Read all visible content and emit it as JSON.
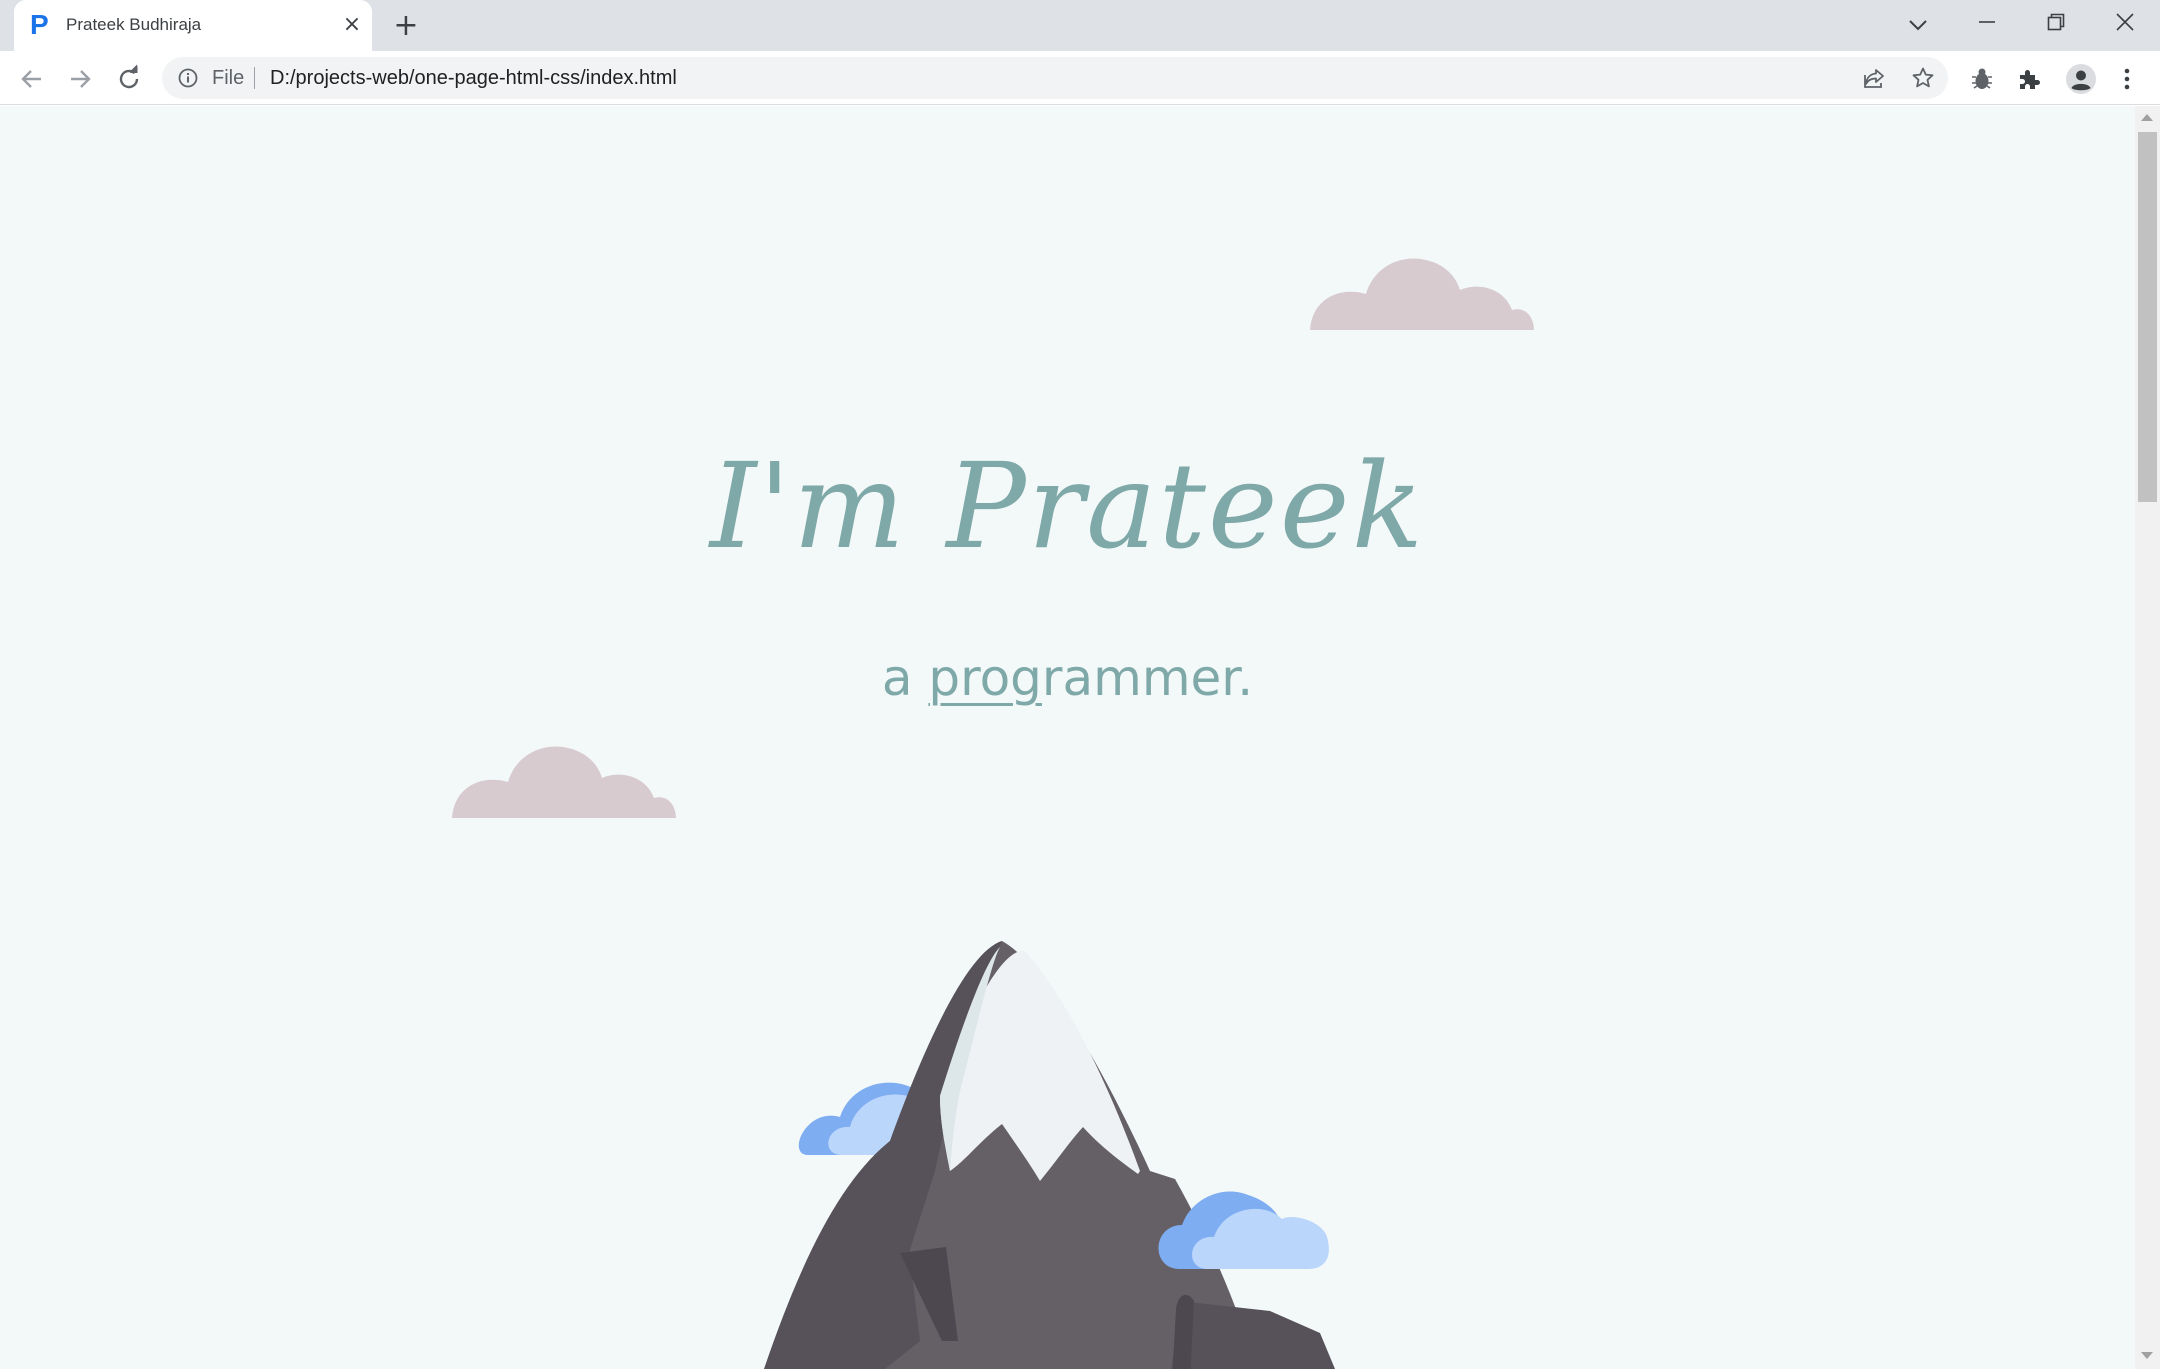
{
  "browser": {
    "tab": {
      "favicon": "P",
      "title": "Prateek Budhiraja",
      "close_icon": "×"
    },
    "new_tab_icon": "+",
    "window_controls": {
      "tab_search": "⌄",
      "minimize": "—",
      "restore": "❐",
      "close": "✕"
    },
    "omnibox": {
      "scheme_label": "File",
      "url": "D:/projects-web/one-page-html-css/index.html"
    },
    "icons": [
      "back-icon",
      "forward-icon",
      "reload-icon",
      "info-icon",
      "share-icon",
      "star-icon",
      "extension-bug-icon",
      "extensions-puzzle-icon",
      "profile-icon",
      "menu-kebab-icon"
    ]
  },
  "page": {
    "title": "I'm Prateek",
    "subtitle_lead": "a ",
    "subtitle_underlined": "prog",
    "subtitle_rest": "rammer."
  },
  "colors": {
    "page_background": "#f3f9f9",
    "heading": "#7fa8a8",
    "pink_cloud": "#d8cbd0",
    "blue_cloud_dark": "#7fadf2",
    "blue_cloud_light": "#bbd6fb",
    "mountain": "#655f66",
    "mountain_shadow": "#57525a",
    "snow": "#eef2f4",
    "snow_shadow": "#dde6e9"
  }
}
